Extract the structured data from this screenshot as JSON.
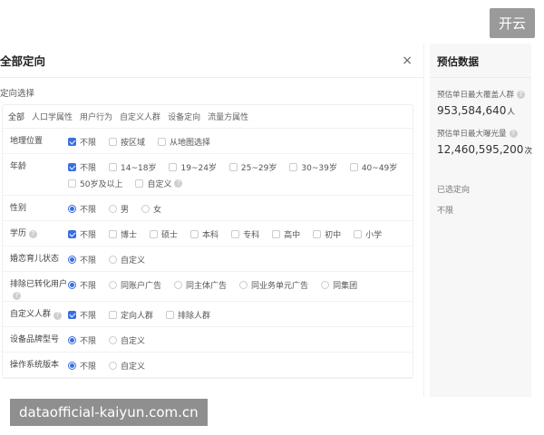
{
  "badge": "开云",
  "panel": {
    "title": "全部定向",
    "close": "×",
    "section_label": "定向选择",
    "tabs": [
      "全部",
      "人口学属性",
      "用户行为",
      "自定义人群",
      "设备定向",
      "流量方属性"
    ],
    "rows": [
      {
        "label": "地理位置",
        "type": "checkbox",
        "options": [
          {
            "text": "不限",
            "on": true
          },
          {
            "text": "按区域",
            "on": false
          },
          {
            "text": "从地图选择",
            "on": false
          }
        ]
      },
      {
        "label": "年龄",
        "type": "checkbox",
        "options": [
          {
            "text": "不限",
            "on": true
          },
          {
            "text": "14~18岁",
            "on": false
          },
          {
            "text": "19~24岁",
            "on": false
          },
          {
            "text": "25~29岁",
            "on": false
          },
          {
            "text": "30~39岁",
            "on": false
          },
          {
            "text": "40~49岁",
            "on": false
          },
          {
            "text": "50岁及以上",
            "on": false
          },
          {
            "text": "自定义",
            "on": false,
            "help": true
          }
        ]
      },
      {
        "label": "性别",
        "type": "radio",
        "options": [
          {
            "text": "不限",
            "on": true
          },
          {
            "text": "男",
            "on": false
          },
          {
            "text": "女",
            "on": false
          }
        ]
      },
      {
        "label": "学历",
        "label_help": true,
        "type": "checkbox",
        "options": [
          {
            "text": "不限",
            "on": true
          },
          {
            "text": "博士",
            "on": false
          },
          {
            "text": "硕士",
            "on": false
          },
          {
            "text": "本科",
            "on": false
          },
          {
            "text": "专科",
            "on": false
          },
          {
            "text": "高中",
            "on": false
          },
          {
            "text": "初中",
            "on": false
          },
          {
            "text": "小学",
            "on": false
          }
        ]
      },
      {
        "label": "婚恋育儿状态",
        "type": "radio",
        "options": [
          {
            "text": "不限",
            "on": true
          },
          {
            "text": "自定义",
            "on": false
          }
        ]
      },
      {
        "label": "排除已转化用户",
        "label_help": true,
        "type": "radio",
        "options": [
          {
            "text": "不限",
            "on": true
          },
          {
            "text": "同账户广告",
            "on": false
          },
          {
            "text": "同主体广告",
            "on": false
          },
          {
            "text": "同业务单元广告",
            "on": false
          },
          {
            "text": "同集团",
            "on": false
          }
        ]
      },
      {
        "label": "自定义人群",
        "label_help": true,
        "type": "checkbox",
        "options": [
          {
            "text": "不限",
            "on": true
          },
          {
            "text": "定向人群",
            "on": false
          },
          {
            "text": "排除人群",
            "on": false
          }
        ]
      },
      {
        "label": "设备品牌型号",
        "type": "radio",
        "options": [
          {
            "text": "不限",
            "on": true
          },
          {
            "text": "自定义",
            "on": false
          }
        ]
      },
      {
        "label": "操作系统版本",
        "type": "radio",
        "options": [
          {
            "text": "不限",
            "on": true
          },
          {
            "text": "自定义",
            "on": false
          }
        ]
      }
    ]
  },
  "estimate": {
    "title": "预估数据",
    "reach_label": "预估单日最大覆盖人群",
    "reach_value": "953,584,640",
    "reach_unit": "人",
    "exposure_label": "预估单日最大曝光量",
    "exposure_value": "12,460,595,200",
    "exposure_unit": "次",
    "selected_label": "已选定向",
    "selected_value": "不限"
  },
  "watermark": "dataofficial-kaiyun.com.cn",
  "colors": {
    "accent": "#3b6fe0"
  }
}
